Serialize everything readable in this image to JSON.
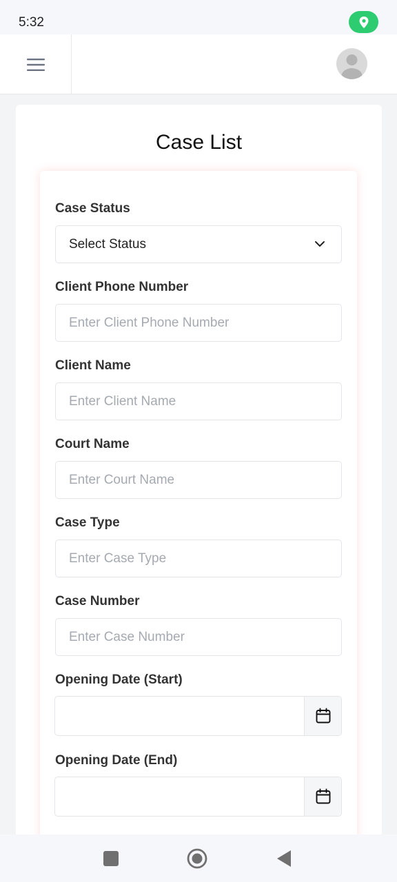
{
  "status_bar": {
    "time": "5:32",
    "location_icon": "location-pin-icon"
  },
  "header": {
    "menu_icon": "hamburger-menu-icon",
    "avatar_icon": "user-avatar-icon"
  },
  "page": {
    "title": "Case List"
  },
  "form": {
    "case_status": {
      "label": "Case Status",
      "value": "Select Status"
    },
    "client_phone": {
      "label": "Client Phone Number",
      "placeholder": "Enter Client Phone Number"
    },
    "client_name": {
      "label": "Client Name",
      "placeholder": "Enter Client Name"
    },
    "court_name": {
      "label": "Court Name",
      "placeholder": "Enter Court Name"
    },
    "case_type": {
      "label": "Case Type",
      "placeholder": "Enter Case Type"
    },
    "case_number": {
      "label": "Case Number",
      "placeholder": "Enter Case Number"
    },
    "opening_date_start": {
      "label": "Opening Date (Start)",
      "value": ""
    },
    "opening_date_end": {
      "label": "Opening Date (End)",
      "value": ""
    }
  },
  "colors": {
    "location_pill": "#2ecc71",
    "card_glow": "#ef786e",
    "label": "#333333",
    "placeholder": "#a5aab1"
  },
  "nav": {
    "recents_icon": "square-recents-icon",
    "home_icon": "circle-home-icon",
    "back_icon": "triangle-back-icon"
  }
}
